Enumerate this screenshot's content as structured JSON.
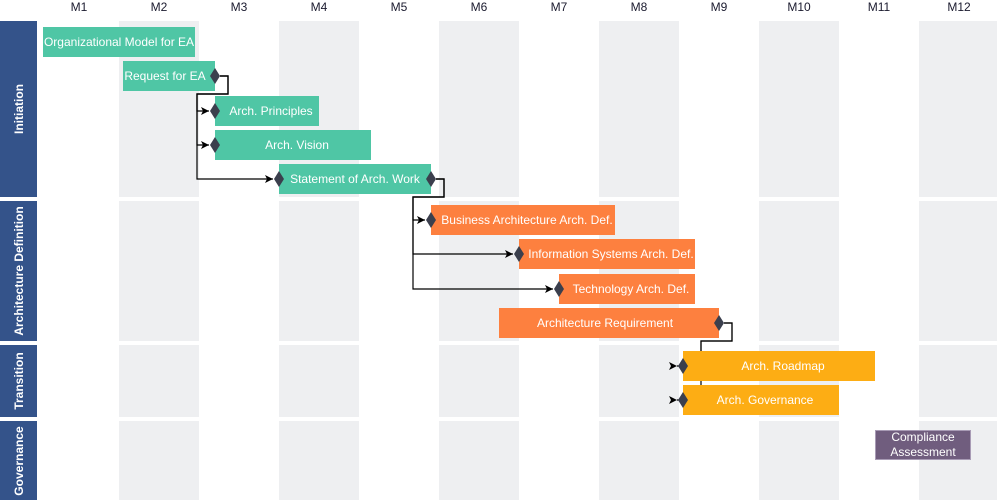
{
  "colors": {
    "lane_header": "#34538a",
    "column_stripe": "#eeeff1",
    "initiation": "#4fc6a5",
    "architecture_definition": "#fd803f",
    "transition": "#fdad14",
    "governance": "#705d7e",
    "connector": "#000000",
    "milestone": "#3b3f4d"
  },
  "months": [
    "M1",
    "M2",
    "M3",
    "M4",
    "M5",
    "M6",
    "M7",
    "M8",
    "M9",
    "M10",
    "M11",
    "M12"
  ],
  "lanes": [
    {
      "id": "initiation",
      "label": "Initiation"
    },
    {
      "id": "architecture_definition",
      "label": "Architecture Definition"
    },
    {
      "id": "transition",
      "label": "Transition"
    },
    {
      "id": "governance",
      "label": "Governance"
    }
  ],
  "tasks": [
    {
      "id": "org_model",
      "lane": "initiation",
      "label": "Organizational Model for EA",
      "start": 0.05,
      "end": 1.95,
      "start_milestone": false,
      "end_milestone": false
    },
    {
      "id": "request_ea",
      "lane": "initiation",
      "label": "Request for EA",
      "start": 1.05,
      "end": 2.2,
      "start_milestone": false,
      "end_milestone": true
    },
    {
      "id": "principles",
      "lane": "initiation",
      "label": "Arch. Principles",
      "start": 2.2,
      "end": 3.5,
      "start_milestone": true,
      "end_milestone": false
    },
    {
      "id": "vision",
      "lane": "initiation",
      "label": "Arch. Vision",
      "start": 2.2,
      "end": 4.15,
      "start_milestone": true,
      "end_milestone": false
    },
    {
      "id": "saw",
      "lane": "initiation",
      "label": "Statement of Arch. Work",
      "start": 3.0,
      "end": 4.9,
      "start_milestone": true,
      "end_milestone": true
    },
    {
      "id": "business",
      "lane": "architecture_definition",
      "label": "Business Architecture Arch. Def.",
      "start": 4.9,
      "end": 7.2,
      "start_milestone": true,
      "end_milestone": false
    },
    {
      "id": "infosys",
      "lane": "architecture_definition",
      "label": "Information Systems Arch. Def.",
      "start": 6.0,
      "end": 8.2,
      "start_milestone": true,
      "end_milestone": false
    },
    {
      "id": "tech",
      "lane": "architecture_definition",
      "label": "Technology Arch. Def.",
      "start": 6.5,
      "end": 8.2,
      "start_milestone": true,
      "end_milestone": false
    },
    {
      "id": "arch_req",
      "lane": "architecture_definition",
      "label": "Architecture Requirement",
      "start": 5.75,
      "end": 8.5,
      "start_milestone": false,
      "end_milestone": true
    },
    {
      "id": "roadmap",
      "lane": "transition",
      "label": "Arch. Roadmap",
      "start": 8.05,
      "end": 10.45,
      "start_milestone": true,
      "end_milestone": false
    },
    {
      "id": "governance_task",
      "lane": "transition",
      "label": "Arch. Governance",
      "start": 8.05,
      "end": 10.0,
      "start_milestone": true,
      "end_milestone": false
    },
    {
      "id": "compliance",
      "lane": "governance",
      "label": "Compliance Assessment",
      "start": 10.45,
      "end": 11.65,
      "start_milestone": false,
      "end_milestone": false
    }
  ],
  "dependencies": [
    {
      "from": "request_ea",
      "to": "principles"
    },
    {
      "from": "request_ea",
      "to": "vision"
    },
    {
      "from": "request_ea",
      "to": "saw"
    },
    {
      "from": "saw",
      "to": "business"
    },
    {
      "from": "saw",
      "to": "infosys"
    },
    {
      "from": "saw",
      "to": "tech"
    },
    {
      "from": "arch_req",
      "to": "roadmap"
    },
    {
      "from": "arch_req",
      "to": "governance_task"
    }
  ]
}
